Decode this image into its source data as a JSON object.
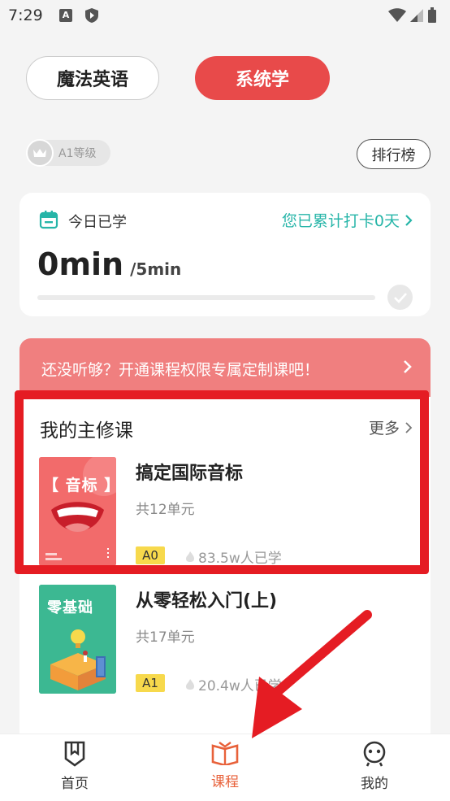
{
  "status_bar": {
    "time": "7:29",
    "icon_a_letter": "A"
  },
  "tabs": [
    {
      "label": "魔法英语",
      "active": false
    },
    {
      "label": "系统学",
      "active": true
    }
  ],
  "level_badge": {
    "label": "A1等级"
  },
  "rank_button": {
    "label": "排行榜"
  },
  "today": {
    "label": "今日已学",
    "checkin_text": "您已累计打卡0天",
    "studied": "0min",
    "goal": "/5min",
    "progress": 0
  },
  "promo": {
    "text": "还没听够？开通课程权限专属定制课吧！"
  },
  "main_courses": {
    "title": "我的主修课",
    "more_label": "更多",
    "items": [
      {
        "cover_text": "【 音标 】",
        "title": "搞定国际音标",
        "units": "共12单元",
        "level": "A0",
        "learners": "83.5w人已学"
      },
      {
        "cover_text": "零基础",
        "title": "从零轻松入门(上)",
        "units": "共17单元",
        "level": "A1",
        "learners": "20.4w人已学"
      }
    ]
  },
  "bottom_nav": [
    {
      "label": "首页",
      "icon": "bookmark-shield-icon"
    },
    {
      "label": "课程",
      "icon": "open-book-icon",
      "active": true
    },
    {
      "label": "我的",
      "icon": "robot-face-icon"
    }
  ],
  "colors": {
    "accent_red": "#e84a4a",
    "teal": "#26b5a8",
    "nav_active": "#e8613a",
    "highlight": "#e51c23"
  }
}
